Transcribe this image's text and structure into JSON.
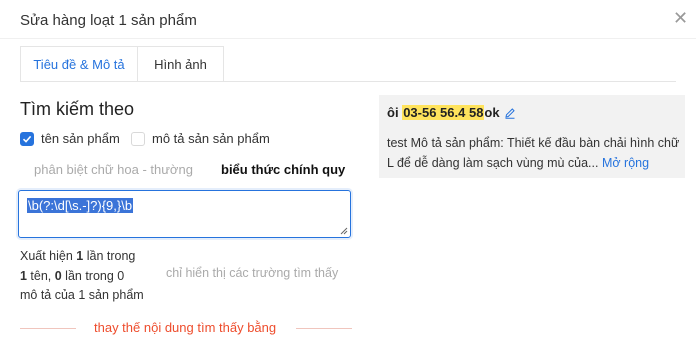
{
  "dialog": {
    "title": "Sửa hàng loạt 1 sản phẩm",
    "close_icon": "close-icon"
  },
  "tabs": [
    {
      "label": "Tiêu đề & Mô tả",
      "active": true
    },
    {
      "label": "Hình ảnh",
      "active": false
    }
  ],
  "search": {
    "title": "Tìm kiếm theo",
    "options": [
      {
        "label": "tên sản phẩm",
        "checked": true
      },
      {
        "label": "mô tả sản sản phẩm",
        "checked": false
      }
    ],
    "case_sensitive_label": "phân biệt chữ hoa - thường",
    "regex_label": "biểu thức chính quy",
    "regex_value": "\\b(?:\\d[\\s.-]?){9,}\\b"
  },
  "stats": {
    "line1_pre": "Xuất hiện ",
    "line1_count": "1",
    "line1_post": " lần trong",
    "line2_count1": "1",
    "line2_mid": " tên, ",
    "line2_count2": "0",
    "line2_post": " lần trong 0",
    "line3": "mô tả của 1 sản phẩm",
    "only_fields_label": "chỉ hiển thị các trường tìm thấy"
  },
  "replace": {
    "label": "thay thế nội dung tìm thấy bằng"
  },
  "preview": {
    "title_pre": "ôi ",
    "title_highlight": "03-56 56.4 58",
    "title_post": " ok",
    "edit_icon": "pencil-icon",
    "description": "test Mô tả sản phẩm: Thiết kế đầu bàn chải hình chữ L để dễ dàng làm sạch vùng mù của...",
    "more_label": "Mở rộng"
  },
  "colors": {
    "accent": "#2673dd",
    "highlight": "#ffe35c",
    "danger": "#ee4d2d"
  }
}
